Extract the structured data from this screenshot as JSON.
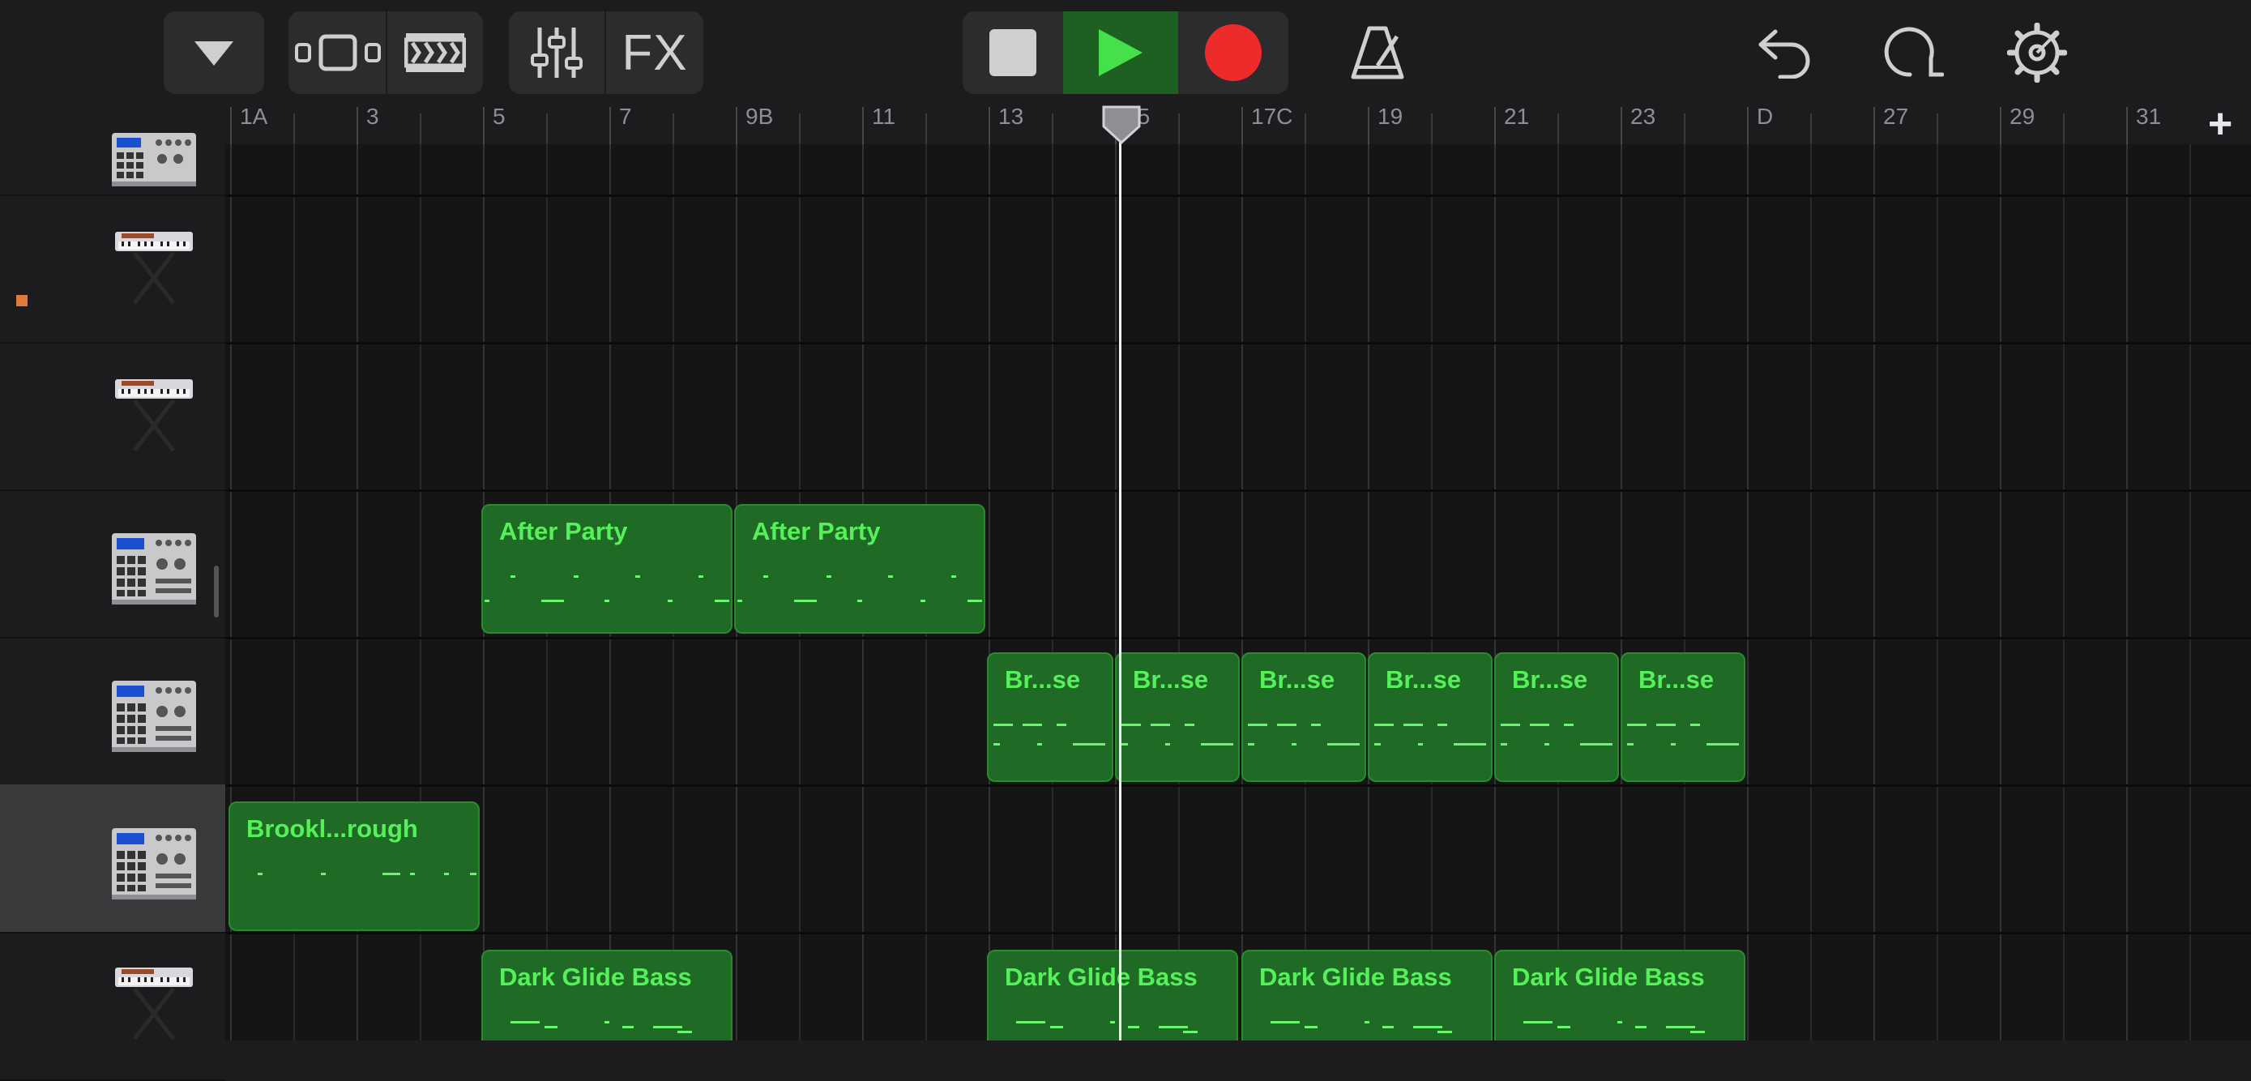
{
  "toolbar": {
    "fx_label": "FX",
    "icons": [
      "chevron-down-icon",
      "tracks-view-icon",
      "live-loops-icon",
      "mixer-icon",
      "fx",
      "stop-icon",
      "play-icon",
      "record-icon",
      "metronome-icon",
      "undo-icon",
      "loop-browser-icon",
      "settings-icon"
    ],
    "play_active_color": "#1e5f22",
    "record_color": "#ee2b2b"
  },
  "ruler": {
    "labels": [
      "1A",
      "3",
      "5",
      "7",
      "9B",
      "11",
      "13",
      "15",
      "17C",
      "19",
      "21",
      "23",
      "D",
      "27",
      "29",
      "31"
    ],
    "add_track_label": "+"
  },
  "tracks": [
    {
      "instrument": "drum-machine-icon",
      "selected": false
    },
    {
      "instrument": "keyboard-icon",
      "selected": false
    },
    {
      "instrument": "keyboard-icon",
      "selected": false
    },
    {
      "instrument": "drum-machine-icon",
      "selected": false
    },
    {
      "instrument": "drum-machine-icon",
      "selected": false
    },
    {
      "instrument": "drum-machine-icon",
      "selected": true
    },
    {
      "instrument": "keyboard-icon",
      "selected": false
    }
  ],
  "regions": [
    {
      "track": 3,
      "name": "After Party"
    },
    {
      "track": 3,
      "name": "After Party"
    },
    {
      "track": 4,
      "name": "Br...se"
    },
    {
      "track": 4,
      "name": "Br...se"
    },
    {
      "track": 4,
      "name": "Br...se"
    },
    {
      "track": 4,
      "name": "Br...se"
    },
    {
      "track": 4,
      "name": "Br...se"
    },
    {
      "track": 4,
      "name": "Br...se"
    },
    {
      "track": 5,
      "name": "Brookl...rough"
    },
    {
      "track": 6,
      "name": "Dark Glide Bass"
    },
    {
      "track": 6,
      "name": "Dark Glide Bass"
    },
    {
      "track": 6,
      "name": "Dark Glide Bass"
    },
    {
      "track": 6,
      "name": "Dark Glide Bass"
    }
  ],
  "colors": {
    "region_fill": "#1f6a24",
    "region_text": "#56f05a",
    "background": "#1c1c1e"
  }
}
